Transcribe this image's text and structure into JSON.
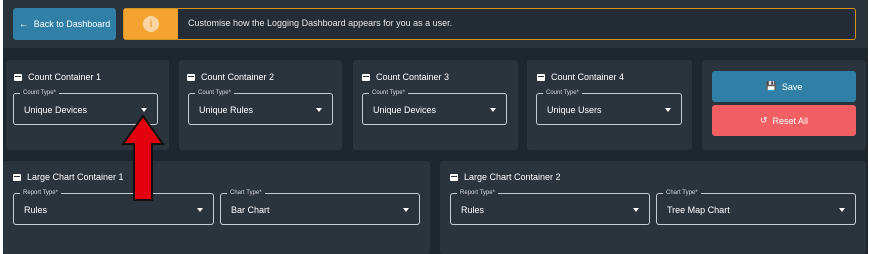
{
  "header": {
    "back_label": "Back to Dashboard",
    "back_icon": "arrow-left-icon",
    "info_icon": "info-icon",
    "info_text": "Customise how the Logging Dashboard appears for you as a user."
  },
  "count_containers": [
    {
      "title": "Count Container 1",
      "field_label": "Count Type*",
      "value": "Unique Devices"
    },
    {
      "title": "Count Container 2",
      "field_label": "Count Type*",
      "value": "Unique Rules"
    },
    {
      "title": "Count Container 3",
      "field_label": "Count Type*",
      "value": "Unique Devices"
    },
    {
      "title": "Count Container 4",
      "field_label": "Count Type*",
      "value": "Unique Users"
    }
  ],
  "actions": {
    "save_label": "Save",
    "save_icon": "save-icon",
    "reset_label": "Reset All",
    "reset_icon": "reset-icon"
  },
  "large_charts": [
    {
      "title": "Large Chart Container 1",
      "report_label": "Report Type*",
      "report_value": "Rules",
      "chart_label": "Chart Type*",
      "chart_value": "Bar Chart"
    },
    {
      "title": "Large Chart Container 2",
      "report_label": "Report Type*",
      "report_value": "Rules",
      "chart_label": "Chart Type*",
      "chart_value": "Tree Map Chart"
    }
  ],
  "colors": {
    "background": "#1e2630",
    "card": "#2b333d",
    "primary": "#2f7fa6",
    "warning": "#f4a230",
    "danger": "#f25f63",
    "annotation_arrow": "#e3000f"
  }
}
